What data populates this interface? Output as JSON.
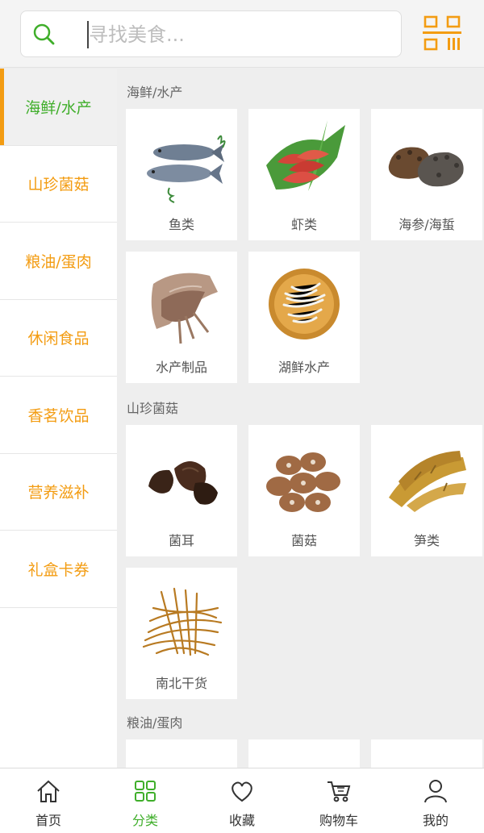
{
  "search": {
    "placeholder": "寻找美食..."
  },
  "sidebar": {
    "items": [
      {
        "label": "海鲜/水产",
        "active": true
      },
      {
        "label": "山珍菌菇",
        "active": false
      },
      {
        "label": "粮油/蛋肉",
        "active": false
      },
      {
        "label": "休闲食品",
        "active": false
      },
      {
        "label": "香茗饮品",
        "active": false
      },
      {
        "label": "营养滋补",
        "active": false
      },
      {
        "label": "礼盒卡券",
        "active": false
      }
    ]
  },
  "sections": [
    {
      "title": "海鲜/水产",
      "items": [
        "鱼类",
        "虾类",
        "海参/海蜇",
        "水产制品",
        "湖鲜水产"
      ]
    },
    {
      "title": "山珍菌菇",
      "items": [
        "菌耳",
        "菌菇",
        "笋类",
        "南北干货"
      ]
    },
    {
      "title": "粮油/蛋肉",
      "items": [
        "",
        "",
        ""
      ]
    }
  ],
  "bottom_nav": [
    {
      "label": "首页",
      "icon": "home-icon"
    },
    {
      "label": "分类",
      "icon": "category-icon",
      "active": true
    },
    {
      "label": "收藏",
      "icon": "heart-icon"
    },
    {
      "label": "购物车",
      "icon": "cart-icon"
    },
    {
      "label": "我的",
      "icon": "user-icon"
    }
  ],
  "colors": {
    "accent_orange": "#f39c12",
    "accent_green": "#3fae2a"
  }
}
